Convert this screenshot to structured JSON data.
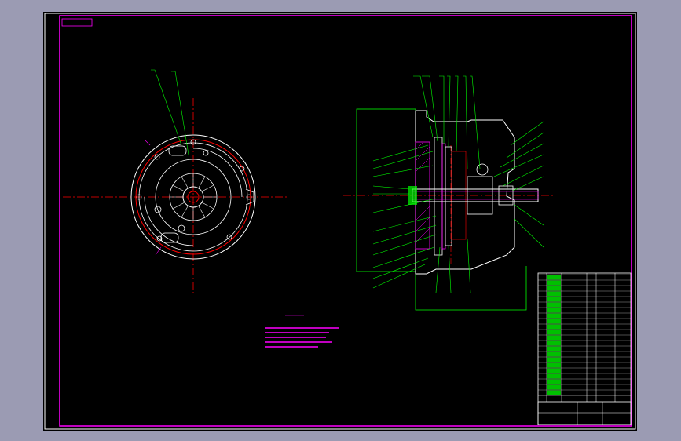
{
  "drawing": {
    "stamp_label": "",
    "section_label": "",
    "notes_title": "",
    "notes": []
  },
  "colors": {
    "background": "#000000",
    "frame": "#ff00ff",
    "outline": "#ffffff",
    "leader": "#00ff00",
    "centerline": "#ff0000",
    "hatch": "#ff00ff",
    "table_green": "#00c000",
    "table_text": "#ffffff"
  },
  "title_block": {
    "name_label": "",
    "number_label": "",
    "left_label": "",
    "row_count": 22
  }
}
